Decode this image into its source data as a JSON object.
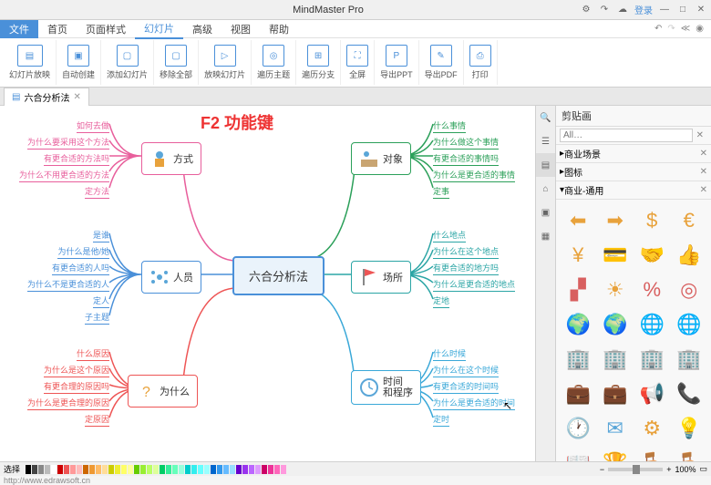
{
  "app": {
    "title": "MindMaster Pro"
  },
  "window": {
    "login": "登录"
  },
  "menu": {
    "file": "文件",
    "start": "首页",
    "page_style": "页面样式",
    "slideshow": "幻灯片",
    "advanced": "高级",
    "view": "视图",
    "help": "帮助"
  },
  "ribbon": {
    "slide_gen": "幻灯片放映",
    "auto_fit": "自动创建",
    "new_slide": "添加幻灯片",
    "del_slide": "移除全部",
    "play": "放映幻灯片",
    "loop": "遍历主题",
    "branch": "遍历分支",
    "fullscreen": "全屏",
    "export_ppt": "导出PPT",
    "export_pdf": "导出PDF",
    "print": "打印"
  },
  "tab": {
    "title": "六合分析法"
  },
  "annotation": "F2 功能键",
  "mindmap": {
    "center": "六合分析法",
    "branches": [
      {
        "id": "method",
        "label": "方式",
        "color": "pink",
        "leaves": [
          "如何去做",
          "为什么要采用这个方法",
          "有更合适的方法吗",
          "为什么不用更合适的方法",
          "定方法"
        ]
      },
      {
        "id": "people",
        "label": "人员",
        "color": "blue",
        "leaves": [
          "是谁",
          "为什么是他/她",
          "有更合适的人吗",
          "为什么不是更合适的人",
          "定人",
          "子主题"
        ]
      },
      {
        "id": "why",
        "label": "为什么",
        "color": "red",
        "leaves": [
          "什么原因",
          "为什么是这个原因",
          "有更合理的原因吗",
          "为什么是更合理的原因",
          "定原因"
        ]
      },
      {
        "id": "object",
        "label": "对象",
        "color": "green",
        "leaves": [
          "什么事情",
          "为什么做这个事情",
          "有更合适的事情吗",
          "为什么是更合适的事情",
          "定事"
        ]
      },
      {
        "id": "place",
        "label": "场所",
        "color": "teal",
        "leaves": [
          "什么地点",
          "为什么在这个地点",
          "有更合适的地方吗",
          "为什么是更合适的地点",
          "定地"
        ]
      },
      {
        "id": "time",
        "label": "时间\n和程序",
        "color": "cyan",
        "leaves": [
          "什么时候",
          "为什么在这个时候",
          "有更合适的时间吗",
          "为什么是更合适的时间",
          "定时"
        ]
      }
    ]
  },
  "panel": {
    "title": "剪贴画",
    "search_placeholder": "All…",
    "categories": {
      "business": "商业场景",
      "icons": "图标",
      "business_sub": "商业-通用"
    }
  },
  "cliparts": [
    "signpost-left",
    "signpost-right",
    "dollar",
    "euro",
    "yen",
    "credit-card",
    "handshake",
    "thumbs-up",
    "puzzle",
    "star-burst",
    "discount",
    "target",
    "globe-search",
    "globe-green",
    "globe-blue",
    "globe-teal",
    "building1",
    "building2",
    "building3",
    "building4",
    "briefcase1",
    "briefcase2",
    "megaphone",
    "phone",
    "clock",
    "envelope",
    "gear-person",
    "head-idea",
    "book",
    "trophy",
    "chair1",
    "chair2"
  ],
  "clip_colors": [
    "#e8a23c",
    "#e8a23c",
    "#e8a23c",
    "#e8a23c",
    "#e8a23c",
    "#555",
    "#e8a23c",
    "#5aa6d8",
    "#d85f5f",
    "#e8a23c",
    "#d85f5f",
    "#d85f5f",
    "#2ca05a",
    "#2ca05a",
    "#5aa6d8",
    "#2ba5a5",
    "#5aa6d8",
    "#2ca05a",
    "#e8a23c",
    "#888",
    "#3b5998",
    "#e8a23c",
    "#d85f5f",
    "#2ca05a",
    "#e8a23c",
    "#5aa6d8",
    "#e8a23c",
    "#5aa6d8",
    "#e8a23c",
    "#e8a23c",
    "#888",
    "#888"
  ],
  "status": {
    "label": "选择",
    "zoom": "100%"
  },
  "footer_link": "http://www.edrawsoft.cn",
  "palette": [
    "#000",
    "#444",
    "#888",
    "#bbb",
    "#fff",
    "#c00",
    "#e55",
    "#f99",
    "#fbb",
    "#c60",
    "#e93",
    "#fb6",
    "#fd9",
    "#cc0",
    "#ee3",
    "#ff6",
    "#ff9",
    "#6c0",
    "#9e3",
    "#bf6",
    "#df9",
    "#0c6",
    "#3e9",
    "#6fb",
    "#9fd",
    "#0cc",
    "#3ee",
    "#6ff",
    "#9ff",
    "#06c",
    "#39e",
    "#6bf",
    "#9df",
    "#60c",
    "#93e",
    "#b6f",
    "#d9f",
    "#c06",
    "#e39",
    "#f6b",
    "#f9d"
  ]
}
